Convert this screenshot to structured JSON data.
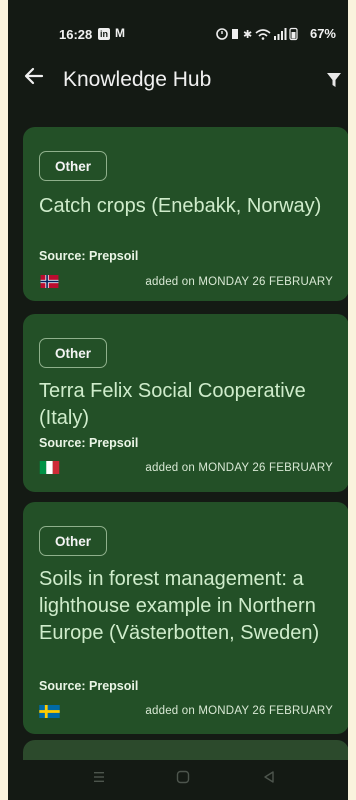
{
  "status": {
    "time": "16:28",
    "battery": "67%",
    "linkedin": "in",
    "mail": "M"
  },
  "header": {
    "title": "Knowledge Hub"
  },
  "cards": [
    {
      "category": "Other",
      "title": "Catch crops (Enebakk, Norway)",
      "source": "Source: Prepsoil",
      "country": "Norway",
      "date": "added on MONDAY 26 FEBRUARY"
    },
    {
      "category": "Other",
      "title": "Terra Felix Social Cooperative (Italy)",
      "source": "Source: Prepsoil",
      "country": "Italy",
      "date": "added on MONDAY 26 FEBRUARY"
    },
    {
      "category": "Other",
      "title": "Soils in forest management: a lighthouse example in Northern Europe (Västerbotten, Sweden)",
      "source": "Source: Prepsoil",
      "country": "Sweden",
      "date": "added on MONDAY 26 FEBRUARY"
    }
  ],
  "nav": {
    "recents_icon": "recents-icon",
    "home_icon": "home-icon",
    "back_icon": "back-triangle-icon"
  },
  "colors": {
    "background": "#141a14",
    "card": "#235027",
    "title_text": "#cfeccb",
    "chip_border": "#8fb08c"
  }
}
